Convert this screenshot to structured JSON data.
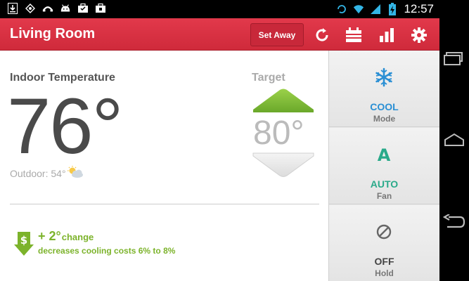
{
  "status_bar": {
    "icons": [
      "download-icon",
      "gps-icon",
      "voicemail-icon",
      "android-icon",
      "briefcase-icon",
      "briefcase-icon"
    ],
    "time": "12:57"
  },
  "app_bar": {
    "title": "Living Room",
    "set_away_label": "Set Away",
    "icons": [
      "refresh-icon",
      "schedule-icon",
      "energy-chart-icon",
      "settings-icon"
    ]
  },
  "indoor": {
    "label": "Indoor Temperature",
    "temp": "76°",
    "outdoor": "Outdoor: 54°"
  },
  "target": {
    "label": "Target",
    "temp": "80°"
  },
  "savings": {
    "change_amount": "+ 2°",
    "change_word": "change",
    "message": "decreases cooling costs 6% to 8%"
  },
  "mode_panel": [
    {
      "value": "COOL",
      "label": "Mode",
      "icon": "snowflake-icon",
      "color": "#2a8fd4"
    },
    {
      "value": "AUTO",
      "label": "Fan",
      "icon": "auto-a-icon",
      "color": "#2aaa8a"
    },
    {
      "value": "OFF",
      "label": "Hold",
      "icon": "no-hold-icon",
      "color": "#444444"
    }
  ],
  "colors": {
    "brand_red": "#d93041",
    "accent_green": "#7cb32b"
  }
}
